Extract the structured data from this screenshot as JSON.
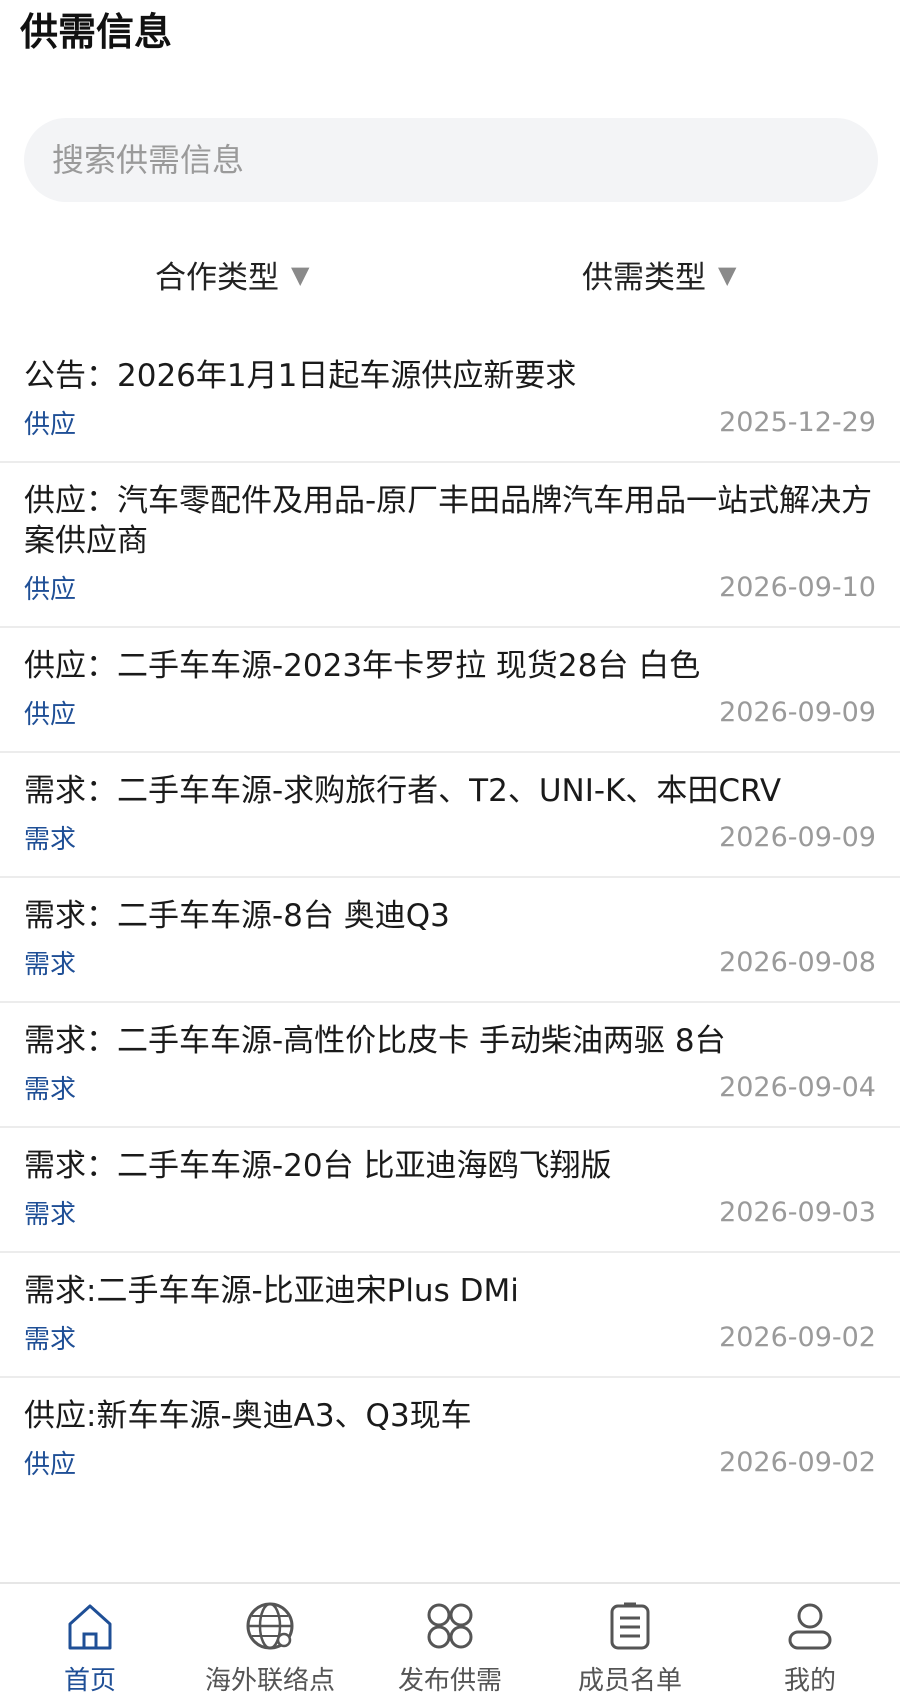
{
  "header": {
    "title": "供需信息"
  },
  "search": {
    "placeholder": "搜索供需信息"
  },
  "filters": [
    {
      "label": "合作类型",
      "icon": "caret-down-icon"
    },
    {
      "label": "供需类型",
      "icon": "caret-down-icon"
    }
  ],
  "list": [
    {
      "title": "公告：2026年1月1日起车源供应新要求",
      "tag": "供应",
      "date": "2025-12-29"
    },
    {
      "title": "供应：汽车零配件及用品-原厂丰田品牌汽车用品一站式解决方案供应商",
      "tag": "供应",
      "date": "2026-09-10"
    },
    {
      "title": "供应：二手车车源-2023年卡罗拉 现货28台 白色",
      "tag": "供应",
      "date": "2026-09-09"
    },
    {
      "title": "需求：二手车车源-求购旅行者、T2、UNI-K、本田CRV",
      "tag": "需求",
      "date": "2026-09-09"
    },
    {
      "title": "需求：二手车车源-8台 奥迪Q3",
      "tag": "需求",
      "date": "2026-09-08"
    },
    {
      "title": "需求：二手车车源-高性价比皮卡 手动柴油两驱 8台",
      "tag": "需求",
      "date": "2026-09-04"
    },
    {
      "title": "需求：二手车车源-20台 比亚迪海鸥飞翔版",
      "tag": "需求",
      "date": "2026-09-03"
    },
    {
      "title": "需求:二手车车源-比亚迪宋Plus DMi",
      "tag": "需求",
      "date": "2026-09-02"
    },
    {
      "title": "供应:新车车源-奥迪A3、Q3现车",
      "tag": "供应",
      "date": "2026-09-02"
    }
  ],
  "tabbar": [
    {
      "label": "首页",
      "icon": "home-icon",
      "active": true
    },
    {
      "label": "海外联络点",
      "icon": "globe-icon",
      "active": false
    },
    {
      "label": "发布供需",
      "icon": "grid-icon",
      "active": false
    },
    {
      "label": "成员名单",
      "icon": "list-icon",
      "active": false
    },
    {
      "label": "我的",
      "icon": "user-icon",
      "active": false
    }
  ],
  "colors": {
    "accent": "#1f4f96",
    "date": "#9a9a9a",
    "search_bg": "#f3f4f6"
  }
}
